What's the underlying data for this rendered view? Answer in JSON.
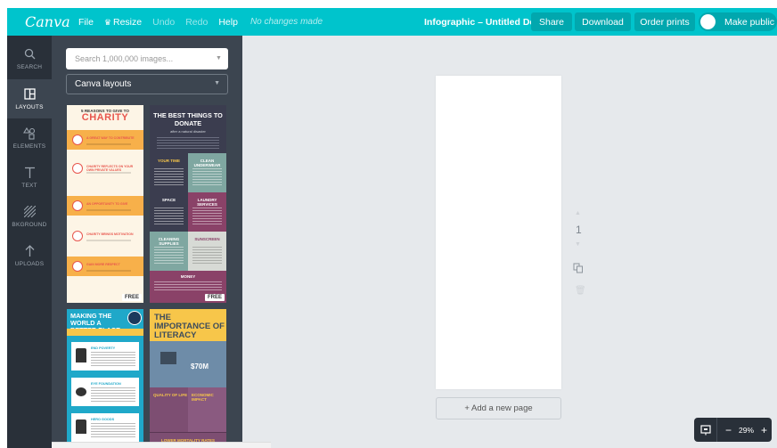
{
  "topbar": {
    "logo": "Canva",
    "menu": {
      "file": "File",
      "resize": "Resize",
      "undo": "Undo",
      "redo": "Redo",
      "help": "Help"
    },
    "status": "No changes made",
    "doc_title": "Infographic – Untitled Design",
    "share": "Share",
    "download": "Download",
    "order_prints": "Order prints",
    "make_public": "Make public",
    "color": "#00c4cc"
  },
  "sidebar": {
    "items": [
      {
        "label": "SEARCH",
        "icon": "search-icon"
      },
      {
        "label": "LAYOUTS",
        "icon": "layouts-icon",
        "active": true
      },
      {
        "label": "ELEMENTS",
        "icon": "elements-icon"
      },
      {
        "label": "TEXT",
        "icon": "text-icon"
      },
      {
        "label": "BKGROUND",
        "icon": "background-icon"
      },
      {
        "label": "UPLOADS",
        "icon": "uploads-icon"
      }
    ]
  },
  "panel": {
    "search_placeholder": "Search 1,000,000 images...",
    "dropdown_value": "Canva layouts",
    "thumbnails": {
      "charity": {
        "subtitle": "5 REASONS TO GIVE TO",
        "title": "CHARITY",
        "rows": [
          "A GREAT WAY TO CONTRIBUTE",
          "CHARITY REFLECTS ON YOUR OWN PRIVATE VALUES",
          "AN OPPORTUNITY TO GIVE",
          "CHARITY BRINGS MOTIVATION",
          "GAIN MORE RESPECT"
        ],
        "badge": "FREE"
      },
      "donate": {
        "title": "THE BEST THINGS TO DONATE",
        "subtitle": "after a natural disaster",
        "cells": [
          "YOUR TIME",
          "CLEAN UNDERWEAR",
          "SPACE",
          "LAUNDRY SERVICES",
          "CLEANING SUPPLIES",
          "SUNSCREEN",
          "MONEY"
        ],
        "badge": "FREE"
      },
      "world": {
        "title": "MAKING THE WORLD A BETTER PLACE",
        "cards": [
          "END POVERTY",
          "EYE FOUNDATION",
          "HERO GOODS"
        ]
      },
      "literacy": {
        "title": "THE IMPORTANCE OF LITERACY",
        "value": "$70M",
        "cells": [
          "QUALITY OF LIFE",
          "ECONOMIC IMPACT"
        ],
        "footer": "LOWER MORTALITY RATES"
      }
    }
  },
  "workspace": {
    "page_number": "1",
    "add_page": "+ Add a new page",
    "zoom": "29%"
  }
}
